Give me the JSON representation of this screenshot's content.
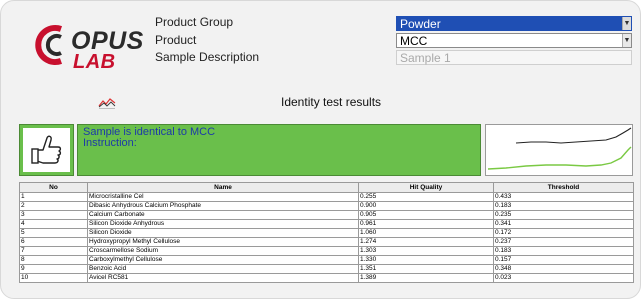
{
  "logo": {
    "line1": "OPUS",
    "line2": "LAB"
  },
  "header": {
    "product_group_label": "Product Group",
    "product_label": "Product",
    "sample_description_label": "Sample Description",
    "product_group_value": "Powder",
    "product_value": "MCC",
    "sample_description_value": "Sample 1"
  },
  "result": {
    "title": "Identity test results",
    "message_line1": "Sample is identical to MCC",
    "message_line2": "Instruction:"
  },
  "colors": {
    "pass_green": "#6abf4b",
    "selected_blue": "#1f4fb4",
    "message_text": "#1d3aa8",
    "logo_red": "#c8102e"
  },
  "icons": {
    "thumb": "thumbs-up-icon",
    "spectrum": "spectrum-compare-icon",
    "dropdown": "chevron-down-icon"
  },
  "table": {
    "columns": [
      "No",
      "Name",
      "Hit Quality",
      "Threshold"
    ],
    "rows": [
      [
        "1",
        "Microcristalline Cel",
        "0.255",
        "0.433"
      ],
      [
        "2",
        "Dibasic Anhydrous Calcium Phosphate",
        "0.900",
        "0.183"
      ],
      [
        "3",
        "Calcium Carbonate",
        "0.905",
        "0.235"
      ],
      [
        "4",
        "Silicon Dioxide Anhydrous",
        "0.961",
        "0.341"
      ],
      [
        "5",
        "Silicon Dioxide",
        "1.060",
        "0.172"
      ],
      [
        "6",
        "Hydroxypropyl Methyl Cellulose",
        "1.274",
        "0.237"
      ],
      [
        "7",
        "Croscarmellose Sodium",
        "1.303",
        "0.183"
      ],
      [
        "8",
        "Carboxylmethyl Cellulose",
        "1.330",
        "0.157"
      ],
      [
        "9",
        "Benzoic Acid",
        "1.351",
        "0.348"
      ],
      [
        "10",
        "Avicel RC581",
        "1.389",
        "0.023"
      ]
    ]
  }
}
